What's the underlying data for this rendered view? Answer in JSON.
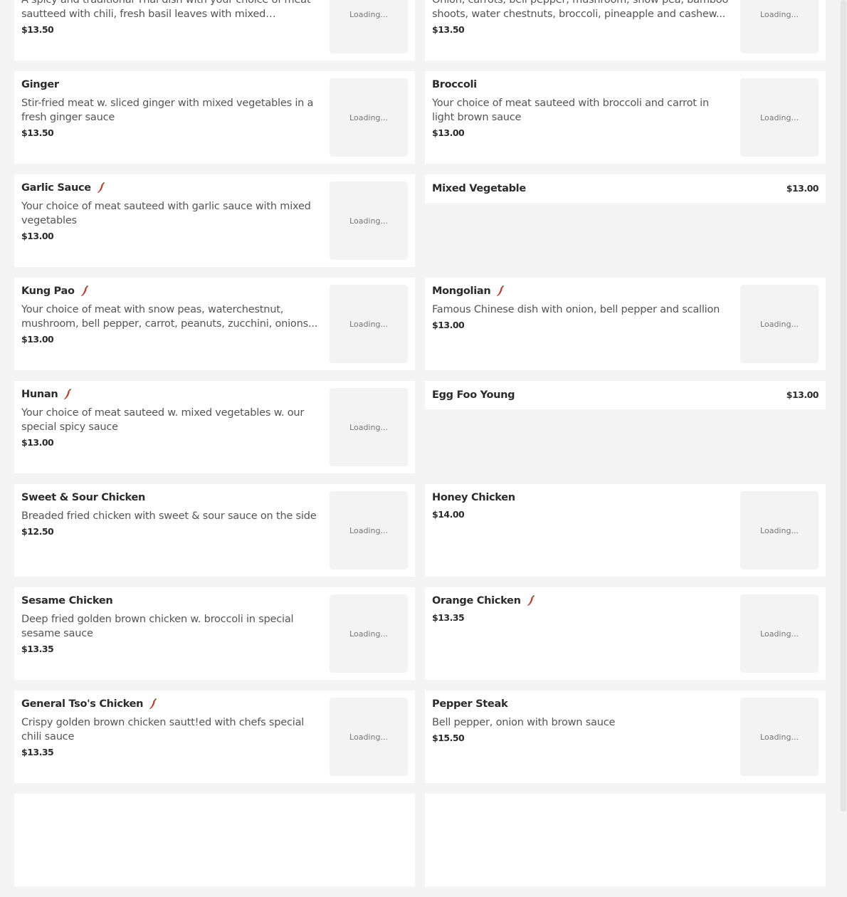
{
  "loading_label": "Loading...",
  "colors": {
    "background": "#f4f4f4",
    "card": "#ffffff",
    "chili": "#c0392b"
  },
  "left_column": [
    {
      "name": "",
      "desc": "A spicy and traditional Thai dish with your choice of meat sautteed with chili, fresh basil leaves with mixed vegetables",
      "price": "$13.50",
      "spicy": false
    },
    {
      "name": "Ginger",
      "desc": "Stir-fried meat w. sliced ginger with mixed vegetables in a fresh ginger sauce",
      "price": "$13.50",
      "spicy": false
    },
    {
      "name": "Garlic Sauce",
      "desc": "Your choice of meat sauteed with garlic sauce with mixed vegetables",
      "price": "$13.00",
      "spicy": true
    },
    {
      "name": "Kung Pao",
      "desc": "Your choice of meat with snow peas, waterchestnut, mushroom, bell pepper, carrot, peanuts, zucchini, onions...",
      "price": "$13.00",
      "spicy": true
    },
    {
      "name": "Hunan",
      "desc": "Your choice of meat sauteed w. mixed vegetables w. our special spicy sauce",
      "price": "$13.00",
      "spicy": true
    },
    {
      "name": "Sweet & Sour Chicken",
      "desc": "Breaded fried chicken with sweet & sour sauce on the side",
      "price": "$12.50",
      "spicy": false
    },
    {
      "name": "Sesame Chicken",
      "desc": "Deep fried golden brown chicken w. broccoli in special sesame sauce",
      "price": "$13.35",
      "spicy": false
    },
    {
      "name": "General Tso's Chicken",
      "desc": "Crispy golden brown chicken sautt!ed with chefs special chili sauce",
      "price": "$13.35",
      "spicy": true
    },
    {
      "name": "",
      "desc": "",
      "price": "",
      "spicy": false
    }
  ],
  "right_column": [
    {
      "name": "",
      "desc": "Onion, carrots, bell pepper, mushroom, snow pea, bamboo shoots, water chestnuts, broccoli, pineapple and cashew...",
      "price": "$13.50",
      "spicy": false
    },
    {
      "name": "Broccoli",
      "desc": "Your choice of meat sauteed with broccoli and carrot in light brown sauce",
      "price": "$13.00",
      "spicy": false
    },
    {
      "name": "Mixed Vegetable",
      "price": "$13.00",
      "slim": true
    },
    {
      "name": "Mongolian",
      "desc": "Famous Chinese dish with onion, bell pepper and scallion",
      "price": "$13.00",
      "spicy": true
    },
    {
      "name": "Egg Foo Young",
      "price": "$13.00",
      "slim": true
    },
    {
      "name": "Honey Chicken",
      "desc": "",
      "price": "$14.00",
      "spicy": false
    },
    {
      "name": "Orange Chicken",
      "desc": "",
      "price": "$13.35",
      "spicy": true
    },
    {
      "name": "Pepper Steak",
      "desc": "Bell pepper, onion with brown sauce",
      "price": "$15.50",
      "spicy": false
    },
    {
      "name": "",
      "desc": "",
      "price": "",
      "spicy": false
    }
  ]
}
